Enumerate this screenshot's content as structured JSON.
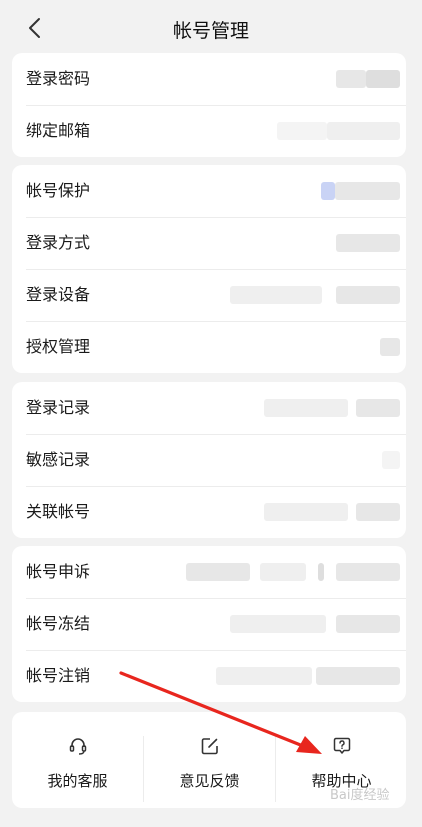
{
  "header": {
    "title": "帐号管理",
    "back_icon": "chevron-left-icon"
  },
  "group1": [
    {
      "label": "登录密码"
    },
    {
      "label": "绑定邮箱"
    }
  ],
  "group2": [
    {
      "label": "帐号保护"
    },
    {
      "label": "登录方式"
    },
    {
      "label": "登录设备"
    },
    {
      "label": "授权管理"
    }
  ],
  "group3": [
    {
      "label": "登录记录"
    },
    {
      "label": "敏感记录"
    },
    {
      "label": "关联帐号"
    }
  ],
  "group4": [
    {
      "label": "帐号申诉"
    },
    {
      "label": "帐号冻结"
    },
    {
      "label": "帐号注销"
    }
  ],
  "bottom": {
    "customer_service": {
      "label": "我的客服",
      "icon": "headset-icon"
    },
    "feedback": {
      "label": "意见反馈",
      "icon": "edit-square-icon"
    },
    "help_center": {
      "label": "帮助中心",
      "icon": "question-bubble-icon"
    }
  },
  "watermark": "Bai度经验",
  "annotation": {
    "arrow_color": "#e8261e",
    "points_to": "help_center"
  },
  "colors": {
    "background": "#f2f2f2",
    "card": "#ffffff",
    "text": "#1a1a1a",
    "divider": "#ececec"
  }
}
